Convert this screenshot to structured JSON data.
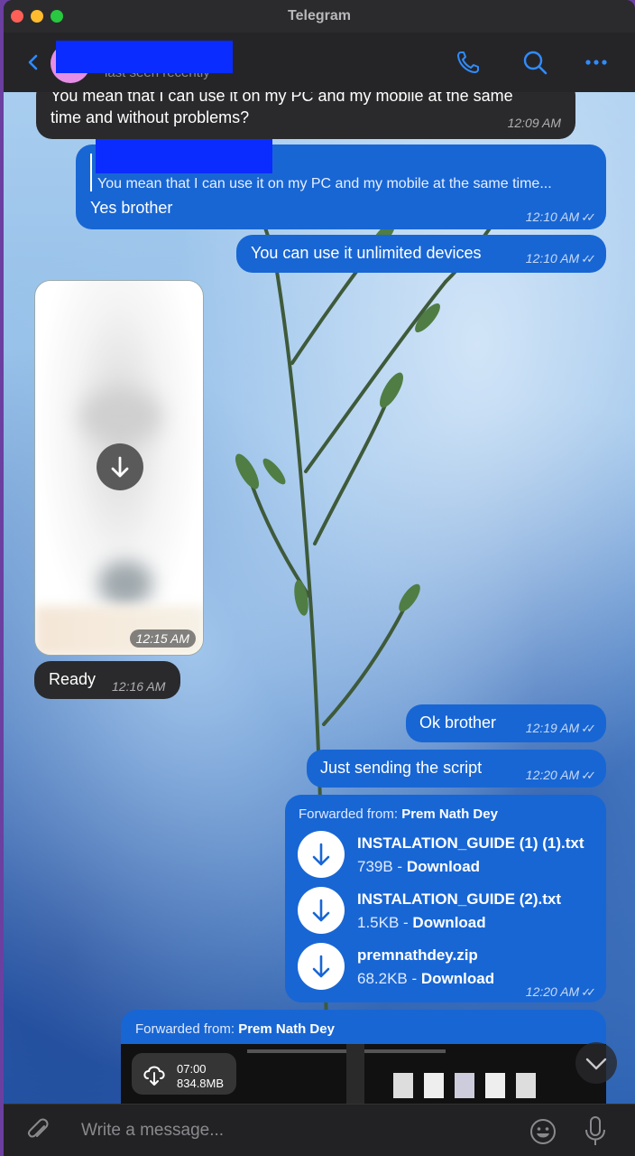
{
  "window": {
    "title": "Telegram"
  },
  "header": {
    "last_seen": "last seen recently"
  },
  "messages": {
    "m1": {
      "text_line1": "You mean that I can use it on my PC and my mobile at the same",
      "text_line2": "time and without problems?",
      "time": "12:09 AM"
    },
    "m2": {
      "quote": "You mean that I can use it on my PC and my mobile at the same time...",
      "text": "Yes brother",
      "time": "12:10 AM"
    },
    "m3": {
      "text": "You can use it unlimited devices",
      "time": "12:10 AM"
    },
    "m4": {
      "time": "12:15 AM"
    },
    "m5": {
      "text": "Ready",
      "time": "12:16 AM"
    },
    "m6": {
      "text": "Ok brother",
      "time": "12:19 AM"
    },
    "m7": {
      "text": "Just sending the script",
      "time": "12:20 AM"
    },
    "m8": {
      "forward_prefix": "Forwarded from:",
      "forward_name": "Prem Nath Dey",
      "time": "12:20 AM",
      "files": [
        {
          "name": "INSTALATION_GUIDE (1) (1).txt",
          "size": "739B",
          "sep": " - ",
          "action": "Download"
        },
        {
          "name": "INSTALATION_GUIDE (2).txt",
          "size": "1.5KB",
          "sep": " - ",
          "action": "Download"
        },
        {
          "name": "premnathdey.zip",
          "size": "68.2KB",
          "sep": " - ",
          "action": "Download"
        }
      ]
    },
    "m9": {
      "forward_prefix": "Forwarded from:",
      "forward_name": "Prem Nath Dey",
      "duration": "07:00",
      "size": "834.8MB"
    }
  },
  "composer": {
    "placeholder": "Write a message..."
  },
  "colors": {
    "accent": "#1866d4",
    "incoming": "#2a2a2c",
    "icon_blue": "#2f8cff"
  }
}
